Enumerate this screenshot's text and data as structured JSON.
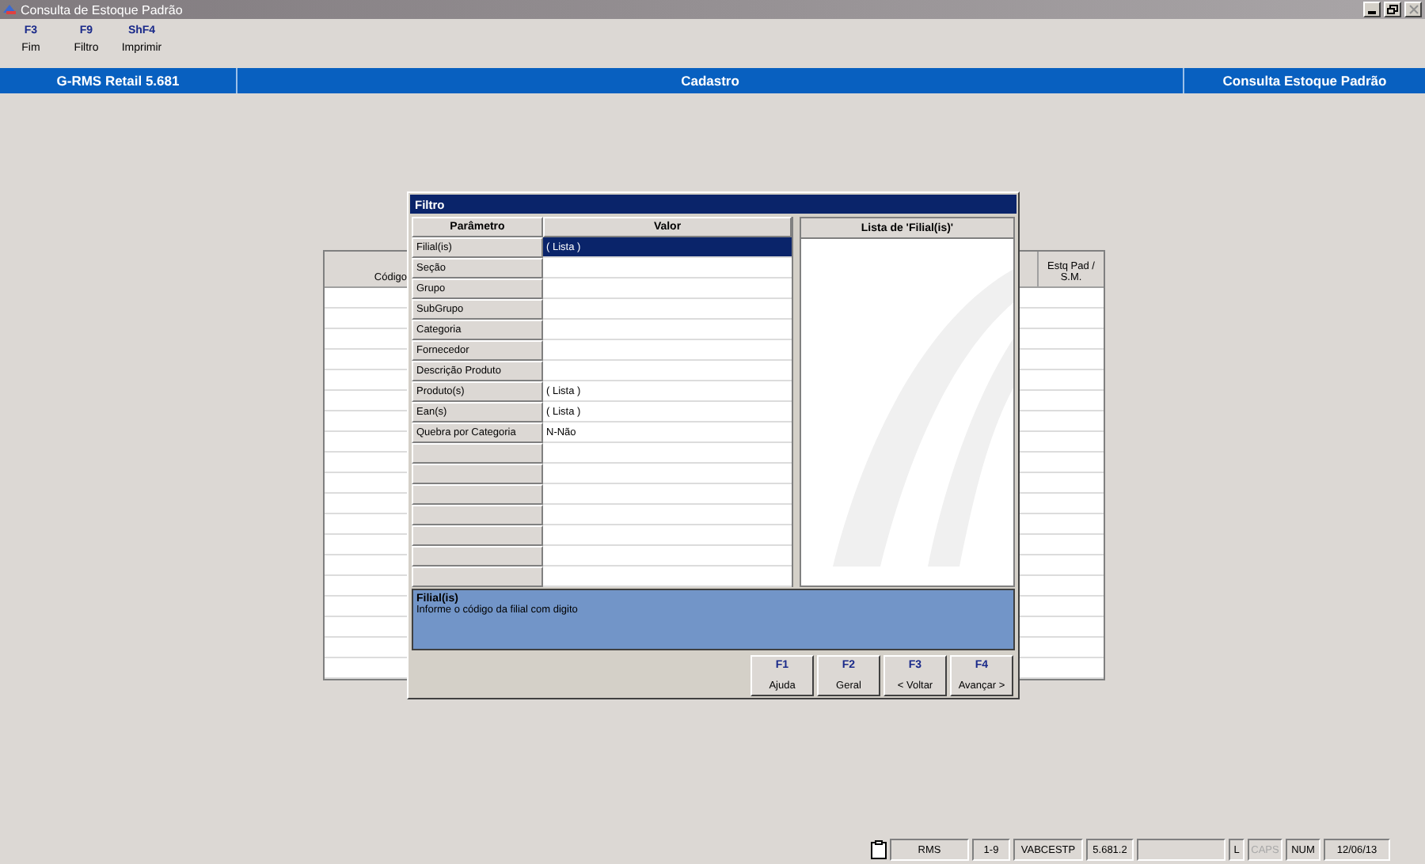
{
  "window": {
    "title": "Consulta de Estoque Padrão"
  },
  "toolbar": [
    {
      "key": "F3",
      "label": "Fim"
    },
    {
      "key": "F9",
      "label": "Filtro"
    },
    {
      "key": "ShF4",
      "label": "Imprimir"
    }
  ],
  "banner": [
    "G-RMS Retail 5.681",
    "Cadastro",
    "Consulta Estoque Padrão"
  ],
  "table": {
    "columns": [
      "Código",
      "Estq Pad / S.M."
    ]
  },
  "dialog": {
    "title": "Filtro",
    "columns": [
      "Parâmetro",
      "Valor"
    ],
    "rows": [
      {
        "parameter": "Filial(is)",
        "value": "( Lista )",
        "selected": true
      },
      {
        "parameter": "Seção",
        "selected": false
      },
      {
        "parameter": "Grupo",
        "selected": false
      },
      {
        "parameter": "SubGrupo",
        "selected": false
      },
      {
        "parameter": "Categoria",
        "selected": false
      },
      {
        "parameter": "Fornecedor",
        "selected": false
      },
      {
        "parameter": "Descrição Produto",
        "selected": false
      },
      {
        "parameter": "Produto(s)",
        "value": "( Lista )",
        "selected": false
      },
      {
        "parameter": "Ean(s)",
        "value": "( Lista )",
        "selected": false
      },
      {
        "parameter": "Quebra por Categoria",
        "value": "N-Não",
        "selected": false
      }
    ],
    "list_title": "Lista de 'Filial(is)'",
    "info": {
      "title": "Filial(is)",
      "text": "Informe o código da filial com digito"
    },
    "buttons": [
      {
        "key": "F1",
        "label": "Ajuda"
      },
      {
        "key": "F2",
        "label": "Geral"
      },
      {
        "key": "F3",
        "label": "< Voltar"
      },
      {
        "key": "F4",
        "label": "Avançar >"
      }
    ]
  },
  "status_bar": [
    {
      "kind": "icon"
    },
    {
      "kind": "text",
      "text": "RMS",
      "disabled": false
    },
    {
      "kind": "text",
      "text": "1-9",
      "disabled": false
    },
    {
      "kind": "text",
      "text": "VABCESTP",
      "disabled": false
    },
    {
      "kind": "text",
      "text": "5.681.2",
      "disabled": false
    },
    {
      "kind": "blank"
    },
    {
      "kind": "text",
      "text": "L",
      "disabled": false
    },
    {
      "kind": "text",
      "text": "CAPS",
      "disabled": true
    },
    {
      "kind": "text",
      "text": "NUM",
      "disabled": false
    },
    {
      "kind": "text",
      "text": "12/06/13",
      "disabled": false
    }
  ]
}
